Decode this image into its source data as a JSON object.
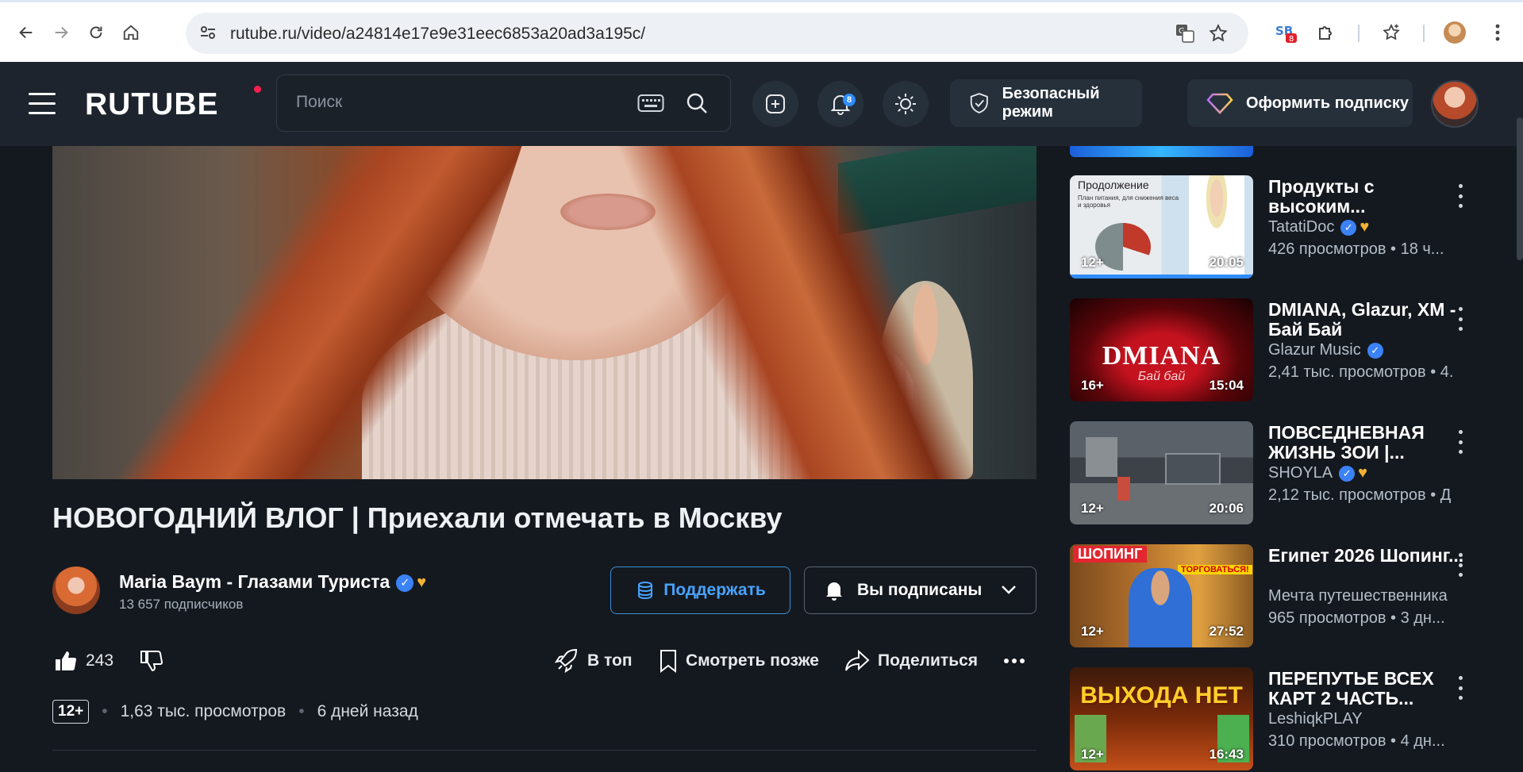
{
  "browser": {
    "url": "rutube.ru/video/a24814e17e9e31eec6853a20ad3a195c/",
    "ext_badge": "8"
  },
  "header": {
    "logo": "RUTUBE",
    "search_placeholder": "Поиск",
    "notifications_count": "8",
    "safe_mode_label": "Безопасный режим",
    "subscribe_label": "Оформить подписку"
  },
  "video": {
    "title": "НОВОГОДНИЙ ВЛОГ | Приехали отмечать в Москву",
    "channel_name": "Maria Baym - Глазами Туриста",
    "subscribers": "13 657 подписчиков",
    "support_label": "Поддержать",
    "subscribed_label": "Вы подписаны",
    "likes": "243",
    "actions": {
      "top": "В топ",
      "watch_later": "Смотреть позже",
      "share": "Поделиться"
    },
    "age": "12+",
    "views": "1,63 тыс. просмотров",
    "published": "6 дней назад"
  },
  "recommendations": [
    {
      "title": "Продукты с высоким...",
      "channel": "TatatiDoc",
      "verified": true,
      "heart": true,
      "stats": "426 просмотров  •  18 ч...",
      "age": "12+",
      "duration": "20:05",
      "thumb_text": "Продолжение",
      "thumb_sub": "План питания, для снижения веса и здоровья"
    },
    {
      "title": "DMIANA, Glazur, XM - Бай Бай",
      "channel": "Glazur Music",
      "verified": true,
      "heart": false,
      "stats": "2,41 тыс. просмотров  •  4.",
      "age": "16+",
      "duration": "15:04",
      "thumb_text": "DMIANA",
      "thumb_sub": "Бай бай"
    },
    {
      "title": "ПОВСЕДНЕВНАЯ ЖИЗНЬ ЗОИ |...",
      "channel": "SHOYLA",
      "verified": true,
      "heart": true,
      "stats": "2,12 тыс. просмотров  •  Д",
      "age": "12+",
      "duration": "20:06"
    },
    {
      "title": "Египет 2026 Шопинг...",
      "channel": "Мечта путешественника",
      "verified": false,
      "heart": false,
      "stats": "965 просмотров  •  3 дн...",
      "age": "12+",
      "duration": "27:52",
      "thumb_text": "ШОПИНГ",
      "thumb_sub": "ТОРГОВАТЬСЯ!"
    },
    {
      "title": "ПЕРЕПУТЬЕ ВСЕХ КАРТ 2 ЧАСТЬ...",
      "channel": "LeshiqkPLAY",
      "verified": false,
      "heart": false,
      "stats": "310 просмотров  •  4 дн...",
      "age": "12+",
      "duration": "16:43",
      "thumb_text": "ВЫХОДА НЕТ"
    }
  ],
  "colors": {
    "page_bg": "#14191f",
    "header_bg": "#1d242d",
    "accent_blue": "#3b82f6",
    "logo_dot": "#ff1e4e"
  }
}
